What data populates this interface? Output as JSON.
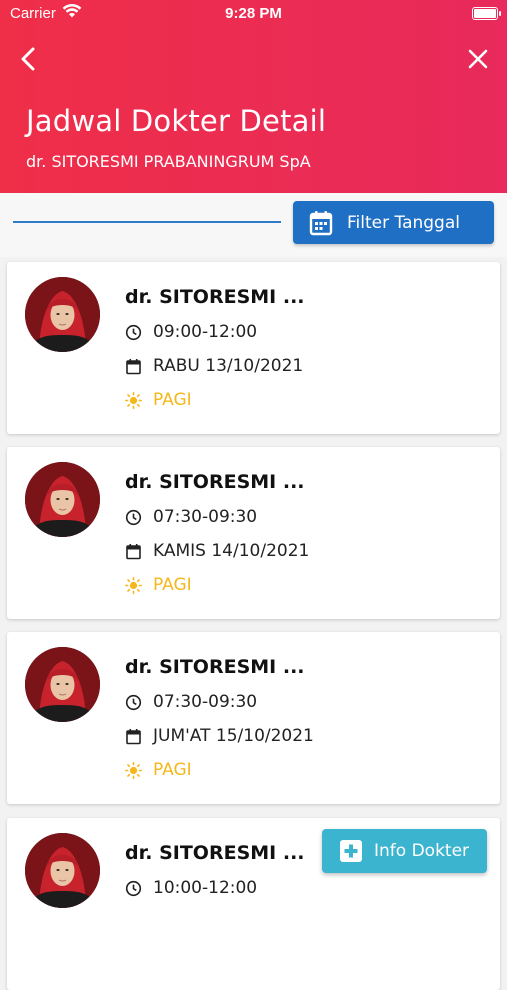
{
  "status_bar": {
    "carrier": "Carrier",
    "time": "9:28 PM"
  },
  "header": {
    "title": "Jadwal Dokter Detail",
    "subtitle": "dr. SITORESMI PRABANINGRUM SpA",
    "back_icon": "chevron-left-icon",
    "close_icon": "close-icon"
  },
  "filter": {
    "label": "Filter Tanggal",
    "icon": "calendar-icon"
  },
  "schedules": [
    {
      "name": "dr. SITORESMI ...",
      "time": "09:00-12:00",
      "date": "RABU 13/10/2021",
      "session": "PAGI"
    },
    {
      "name": "dr. SITORESMI ...",
      "time": "07:30-09:30",
      "date": "KAMIS 14/10/2021",
      "session": "PAGI"
    },
    {
      "name": "dr. SITORESMI ...",
      "time": "07:30-09:30",
      "date": "JUM'AT 15/10/2021",
      "session": "PAGI"
    },
    {
      "name": "dr. SITORESMI ...",
      "time": "10:00-12:00"
    }
  ],
  "fab": {
    "label": "Info Dokter",
    "icon": "plus-square-icon"
  },
  "colors": {
    "header_start": "#ef2e48",
    "header_end": "#e82a5c",
    "filter_button": "#1f6fc5",
    "session": "#f5b81c",
    "info_button": "#3bb4cf"
  }
}
